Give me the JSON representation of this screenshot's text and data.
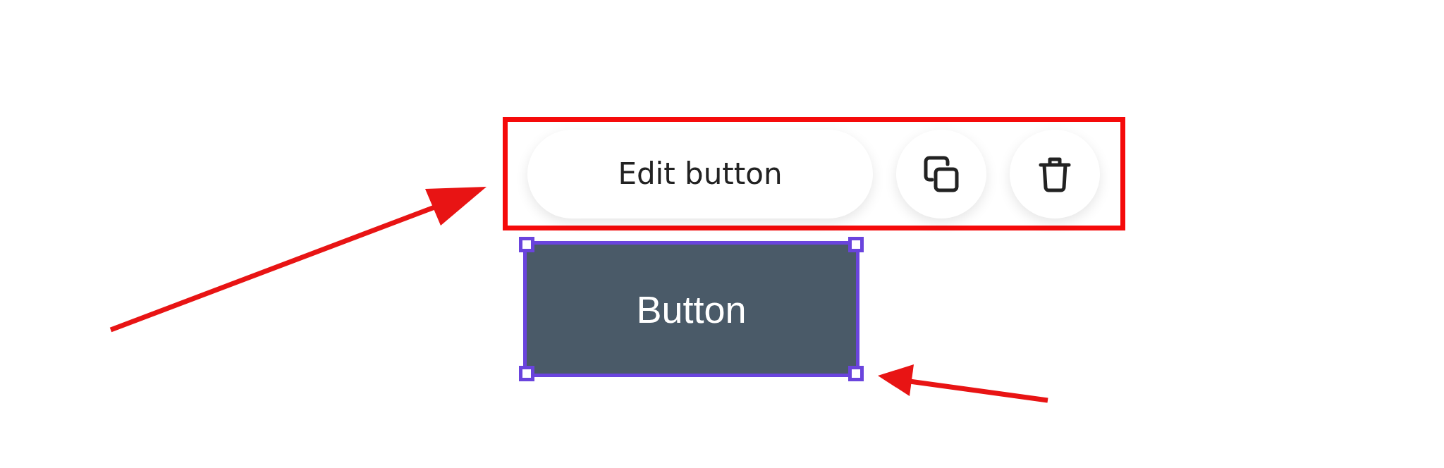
{
  "toolbar": {
    "edit_label": "Edit button",
    "highlighted": true
  },
  "element": {
    "label": "Button",
    "selected": true
  }
}
